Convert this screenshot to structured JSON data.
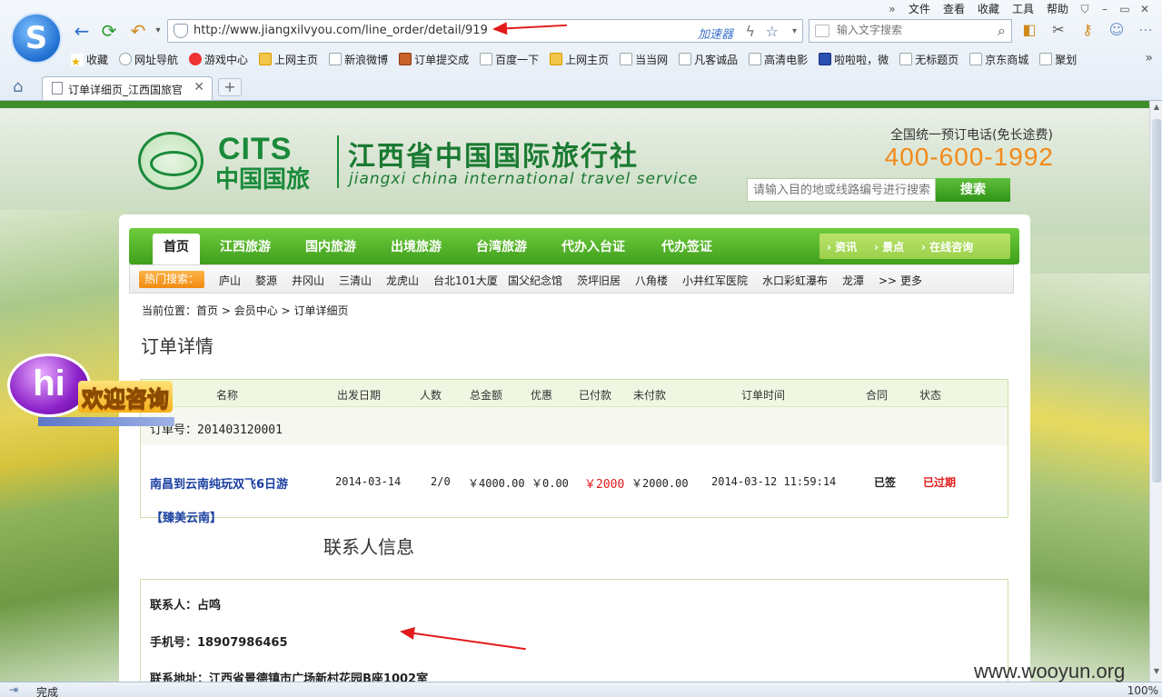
{
  "browser": {
    "menu": [
      "文件",
      "查看",
      "收藏",
      "工具",
      "帮助"
    ],
    "url": "http://www.jiangxilvyou.com/line_order/detail/919",
    "accelerator": "加速器",
    "search_placeholder": "输入文字搜索",
    "bookmarks": [
      "收藏",
      "网址导航",
      "游戏中心",
      "上网主页",
      "新浪微博",
      "订单提交成",
      "百度一下",
      "上网主页",
      "当当网",
      "凡客诚品",
      "高清电影",
      "啦啦啦，微",
      "无标题页",
      "京东商城",
      "聚划"
    ],
    "tab_title": "订单详细页_江西国旅官",
    "status": "完成",
    "zoom": "100%"
  },
  "site": {
    "brand_en_short": "CITS",
    "brand_cn_short": "中国国旅",
    "title": "江西省中国国际旅行社",
    "title_en": "jiangxi china international travel service",
    "hotline_label": "全国统一预订电话(免长途费)",
    "hotline": "400-600-1992",
    "search_placeholder": "请输入目的地或线路编号进行搜索",
    "search_button": "搜索",
    "nav": [
      "首页",
      "江西旅游",
      "国内旅游",
      "出境旅游",
      "台湾旅游",
      "代办入台证",
      "代办签证"
    ],
    "quick_links": [
      "资讯",
      "景点",
      "在线咨询"
    ],
    "hot_label": "热门搜索：",
    "hot_items": [
      "庐山",
      "婺源",
      "井冈山",
      "三清山",
      "龙虎山",
      "台北101大厦",
      "国父纪念馆",
      "茨坪旧居",
      "八角楼",
      "小井红军医院",
      "水口彩虹瀑布",
      "龙潭",
      "更多"
    ],
    "hot_more_prefix": ">>",
    "hi_label": "欢迎咨询",
    "hi_text": "hi"
  },
  "breadcrumb": {
    "prefix": "当前位置：",
    "items": [
      "首页",
      "会员中心",
      "订单详细页"
    ]
  },
  "order": {
    "heading": "订单详情",
    "columns": [
      "名称",
      "出发日期",
      "人数",
      "总金额",
      "优惠",
      "已付款",
      "未付款",
      "订单时间",
      "合同",
      "状态"
    ],
    "order_no_label": "订单号：",
    "order_no": "201403120001",
    "row": {
      "name": "南昌到云南纯玩双飞6日游",
      "date": "2014-03-14",
      "people": "2/0",
      "total": "￥4000.00",
      "discount": "￥0.00",
      "paid": "￥2000",
      "unpaid": "￥2000.00",
      "time": "2014-03-12 11:59:14",
      "contract": "已签",
      "status": "已过期"
    },
    "tag": "【臻美云南】"
  },
  "contact": {
    "heading": "联系人信息",
    "name_label": "联系人：",
    "name": "占鸣",
    "phone_label": "手机号：",
    "phone": "18907986465",
    "address_label": "联系地址：",
    "address": "江西省景德镇市广场新村花园B座1002室"
  },
  "watermark": "www.wooyun.org",
  "colors": {
    "accent_green": "#3f9f1c",
    "hotline_orange": "#f28a1a",
    "status_red": "#e21a1a",
    "link_blue": "#1a3fa0"
  }
}
